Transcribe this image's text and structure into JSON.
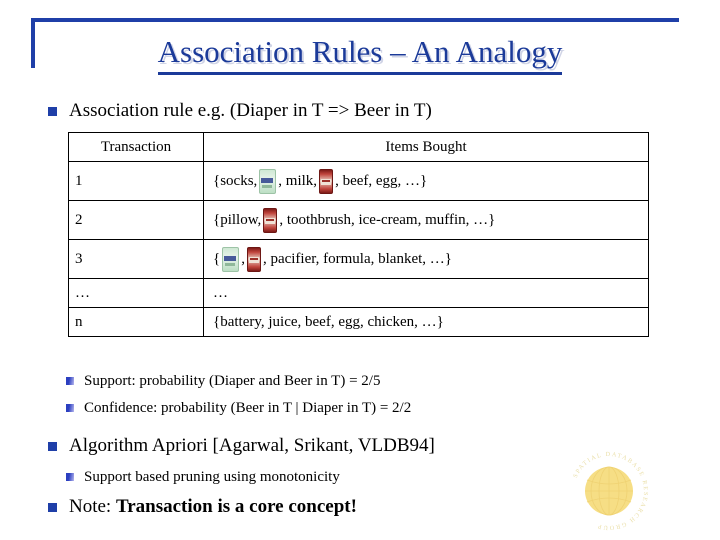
{
  "slide": {
    "title": "Association Rules – An Analogy",
    "title_color": "#1b3a99",
    "frame_color": "#1f3fa8",
    "background": "#ffffff"
  },
  "bullets": {
    "rule": "Association rule e.g. (Diaper in T => Beer in T)",
    "support": "Support: probability (Diaper and Beer in T) = 2/5",
    "confidence": "Confidence: probability (Beer in T | Diaper in T) = 2/2",
    "algorithm": "Algorithm Apriori [Agarwal, Srikant, VLDB94]",
    "pruning": "Support based pruning using monotonicity",
    "note_prefix": "Note: ",
    "note_bold": "Transaction is a core concept!"
  },
  "table": {
    "headers": [
      "Transaction",
      "Items Bought"
    ],
    "rows": [
      {
        "id": "1",
        "parts": [
          {
            "type": "text",
            "value": "{socks,"
          },
          {
            "type": "icon",
            "value": "diaper-icon"
          },
          {
            "type": "text",
            "value": ", milk,"
          },
          {
            "type": "icon",
            "value": "beer-icon"
          },
          {
            "type": "text",
            "value": ", beef, egg, …}"
          }
        ]
      },
      {
        "id": "2",
        "parts": [
          {
            "type": "text",
            "value": "{pillow,"
          },
          {
            "type": "icon",
            "value": "beer-icon"
          },
          {
            "type": "text",
            "value": ", toothbrush, ice-cream, muffin, …}"
          }
        ]
      },
      {
        "id": "3",
        "parts": [
          {
            "type": "text",
            "value": "{"
          },
          {
            "type": "icon",
            "value": "diaper-icon"
          },
          {
            "type": "text",
            "value": " ,"
          },
          {
            "type": "icon",
            "value": "beer-icon"
          },
          {
            "type": "text",
            "value": ", pacifier, formula, blanket, …}"
          }
        ]
      },
      {
        "id": "…",
        "parts": [
          {
            "type": "text",
            "value": "…"
          }
        ]
      },
      {
        "id": "n",
        "parts": [
          {
            "type": "text",
            "value": "{battery, juice, beef, egg, chicken, …}"
          }
        ]
      }
    ]
  },
  "logo": {
    "text": "SPATIAL DATABASE RESEARCH GROUP",
    "globe_color": "#f5dd82",
    "ring_color": "#e8d79a"
  }
}
